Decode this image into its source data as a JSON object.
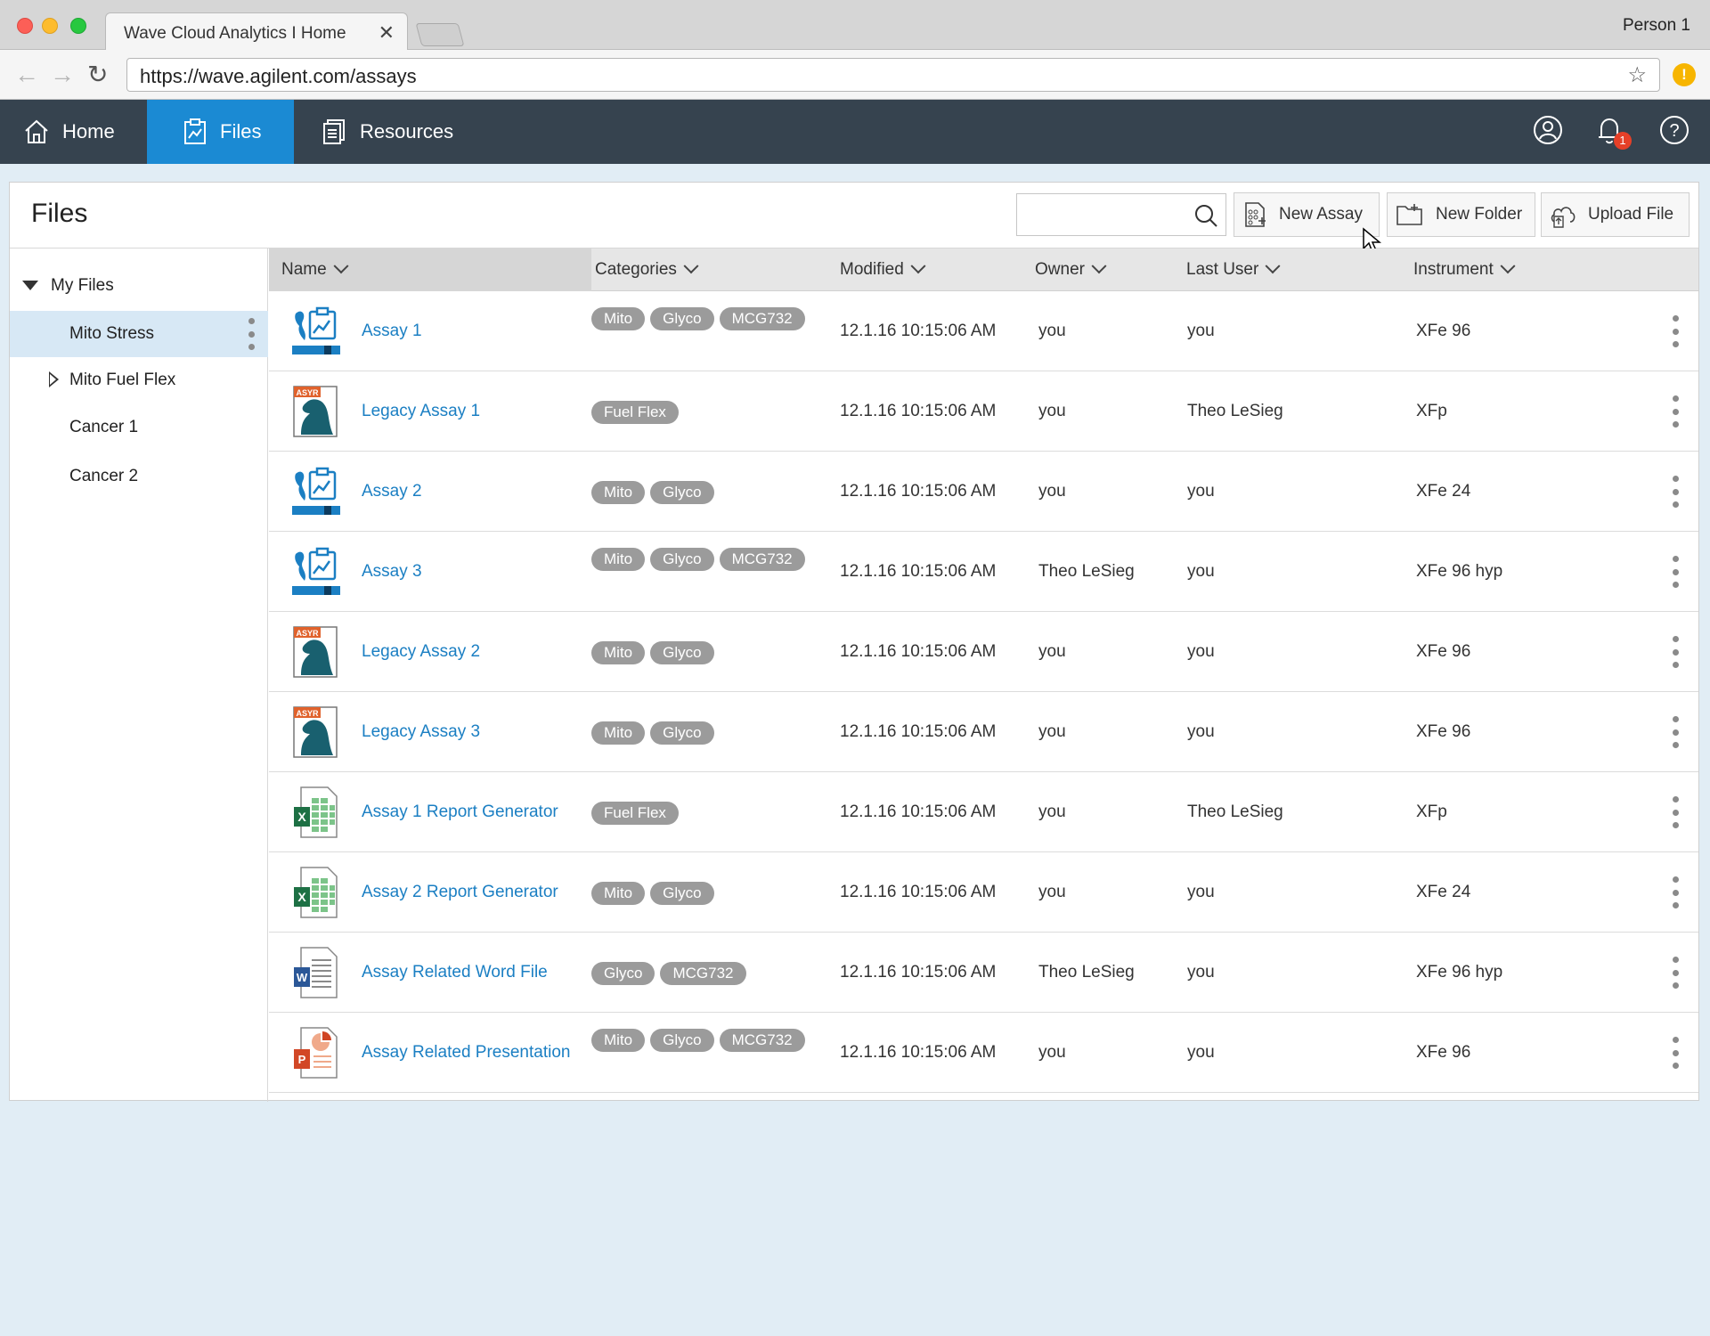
{
  "browser": {
    "tab_title": "Wave Cloud Analytics I Home",
    "tab_close": "✕",
    "profile": "Person 1",
    "url": "https://wave.agilent.com/assays"
  },
  "nav": {
    "home": "Home",
    "files": "Files",
    "resources": "Resources",
    "notification_count": "1"
  },
  "page": {
    "title": "Files",
    "search_placeholder": "",
    "new_assay": "New Assay",
    "new_folder": "New Folder",
    "upload_file": "Upload File"
  },
  "sidebar": {
    "root": "My Files",
    "items": [
      "Mito Stress",
      "Mito Fuel Flex",
      "Cancer 1",
      "Cancer 2"
    ],
    "selected": "Mito Stress"
  },
  "table": {
    "columns": {
      "name": "Name",
      "categories": "Categories",
      "modified": "Modified",
      "owner": "Owner",
      "last_user": "Last User",
      "instrument": "Instrument"
    },
    "rows": [
      {
        "name": "Assay 1",
        "icon": "assay-icon",
        "categories": [
          "Mito",
          "Glyco",
          "MCG732"
        ],
        "modified": "12.1.16  10:15:06 AM",
        "owner": "you",
        "last_user": "you",
        "instrument": "XFe 96"
      },
      {
        "name": "Legacy Assay 1",
        "icon": "legacy-assay-icon",
        "categories": [
          "Fuel Flex"
        ],
        "modified": "12.1.16  10:15:06 AM",
        "owner": "you",
        "last_user": "Theo LeSieg",
        "instrument": "XFp"
      },
      {
        "name": "Assay 2",
        "icon": "assay-icon",
        "categories": [
          "Mito",
          "Glyco"
        ],
        "modified": "12.1.16  10:15:06 AM",
        "owner": "you",
        "last_user": "you",
        "instrument": "XFe 24"
      },
      {
        "name": "Assay 3",
        "icon": "assay-icon",
        "categories": [
          "Mito",
          "Glyco",
          "MCG732"
        ],
        "modified": "12.1.16  10:15:06 AM",
        "owner": "Theo LeSieg",
        "last_user": "you",
        "instrument": "XFe 96 hyp"
      },
      {
        "name": "Legacy Assay 2",
        "icon": "legacy-assay-icon",
        "categories": [
          "Mito",
          "Glyco"
        ],
        "modified": "12.1.16  10:15:06 AM",
        "owner": "you",
        "last_user": "you",
        "instrument": "XFe 96"
      },
      {
        "name": "Legacy Assay 3",
        "icon": "legacy-assay-icon",
        "categories": [
          "Mito",
          "Glyco"
        ],
        "modified": "12.1.16  10:15:06 AM",
        "owner": "you",
        "last_user": "you",
        "instrument": "XFe 96"
      },
      {
        "name": "Assay 1 Report Generator",
        "icon": "excel-icon",
        "categories": [
          "Fuel Flex"
        ],
        "modified": "12.1.16  10:15:06 AM",
        "owner": "you",
        "last_user": "Theo LeSieg",
        "instrument": "XFp"
      },
      {
        "name": "Assay 2 Report Generator",
        "icon": "excel-icon",
        "categories": [
          "Mito",
          "Glyco"
        ],
        "modified": "12.1.16  10:15:06 AM",
        "owner": "you",
        "last_user": "you",
        "instrument": "XFe 24"
      },
      {
        "name": "Assay Related Word File",
        "icon": "word-icon",
        "categories": [
          "Glyco",
          "MCG732"
        ],
        "modified": "12.1.16  10:15:06 AM",
        "owner": "Theo LeSieg",
        "last_user": "you",
        "instrument": "XFe 96 hyp"
      },
      {
        "name": "Assay Related Presentation",
        "icon": "powerpoint-icon",
        "categories": [
          "Mito",
          "Glyco",
          "MCG732"
        ],
        "modified": "12.1.16  10:15:06 AM",
        "owner": "you",
        "last_user": "you",
        "instrument": "XFe 96"
      }
    ]
  },
  "colors": {
    "nav_bg": "#36434f",
    "nav_active": "#1b8ad3",
    "link": "#1b7fc3",
    "chip": "#9b9b9b",
    "sidebar_selected": "#d7e8f5"
  }
}
